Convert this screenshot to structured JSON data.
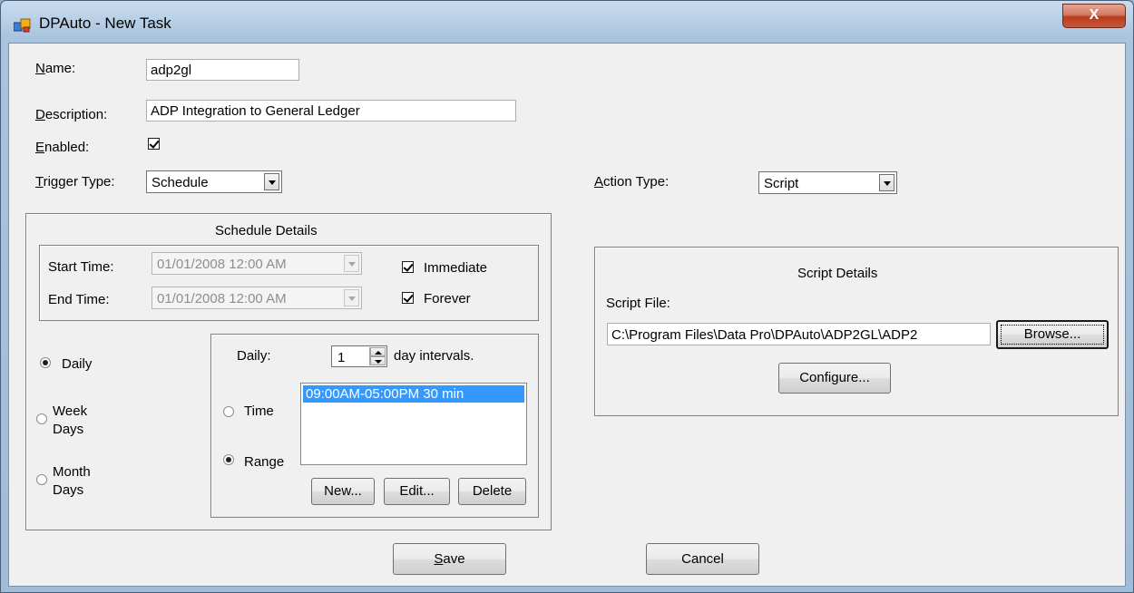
{
  "window": {
    "title": "DPAuto - New Task",
    "close_glyph": "X",
    "icon": "app-icon"
  },
  "form": {
    "name_label_accel": "N",
    "name_label_rest": "ame:",
    "name_value": "adp2gl",
    "description_label_accel": "D",
    "description_label_rest": "escription:",
    "description_value": "ADP Integration to General Ledger",
    "enabled_label_accel": "E",
    "enabled_label_rest": "nabled:",
    "enabled_checked": true,
    "trigger_label_accel": "T",
    "trigger_label_rest": "rigger Type:",
    "trigger_value": "Schedule",
    "action_label_accel": "A",
    "action_label_rest": "ction Type:",
    "action_value": "Script"
  },
  "schedule": {
    "title": "Schedule Details",
    "start_label": "Start Time:",
    "start_value": "01/01/2008 12:00 AM",
    "end_label": "End Time:",
    "end_value": "01/01/2008 12:00 AM",
    "immediate_label": "Immediate",
    "forever_label": "Forever",
    "radio_daily": "Daily",
    "radio_week_1": "Week",
    "radio_week_2": "Days",
    "radio_month_1": "Month",
    "radio_month_2": "Days",
    "daily_label": "Daily:",
    "interval_value": "1",
    "interval_suffix": "day intervals.",
    "time_label": "Time",
    "range_label": "Range",
    "list_items": [
      "09:00AM-05:00PM 30 min"
    ],
    "new_button": "New...",
    "edit_button": "Edit...",
    "delete_button": "Delete"
  },
  "script": {
    "title": "Script Details",
    "file_label": "Script File:",
    "file_value": "C:\\Program Files\\Data Pro\\DPAuto\\ADP2GL\\ADP2",
    "browse_button": "Browse...",
    "configure_button": "Configure..."
  },
  "footer": {
    "save_accel": "S",
    "save_rest": "ave",
    "cancel": "Cancel"
  }
}
